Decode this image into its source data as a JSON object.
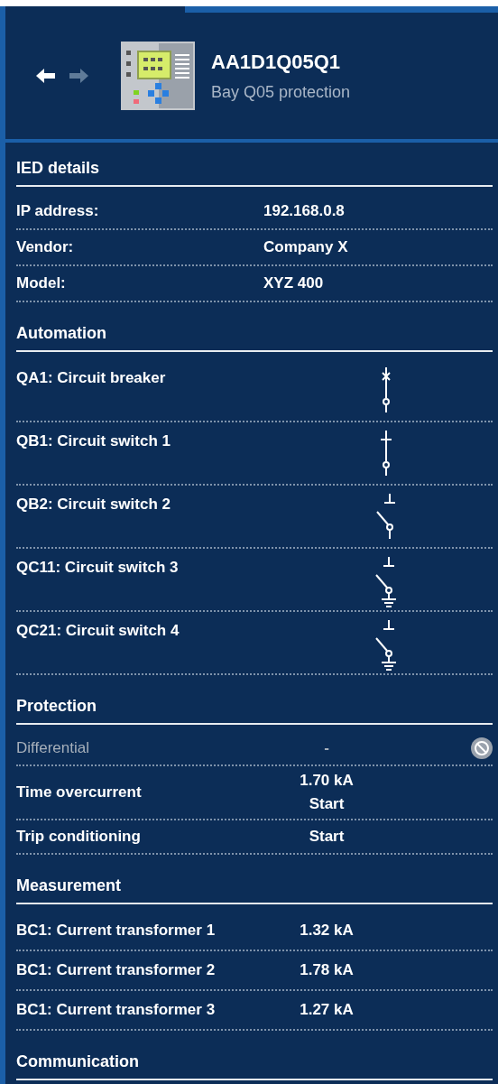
{
  "navigation": {
    "back": {
      "disabled": false
    },
    "forward": {
      "disabled": true
    }
  },
  "device": {
    "title": "AA1D1Q05Q1",
    "subtitle": "Bay Q05 protection"
  },
  "sections": [
    {
      "kind": "details",
      "heading": "IED details",
      "rows": [
        {
          "label": "IP address:",
          "values": [
            "192.168.0.8"
          ],
          "disabled": false
        },
        {
          "label": "Vendor:",
          "values": [
            "Company X"
          ],
          "disabled": false
        },
        {
          "label": "Model:",
          "values": [
            "XYZ 400"
          ],
          "disabled": false
        }
      ]
    },
    {
      "kind": "automation",
      "heading": "Automation",
      "rows": [
        {
          "label": "QA1: Circuit breaker",
          "kind": "breaker"
        },
        {
          "label": "QB1: Circuit switch 1",
          "kind": "closed"
        },
        {
          "label": "QB2: Circuit switch 2",
          "kind": "open"
        },
        {
          "label": "QC11: Circuit switch 3",
          "kind": "earthed"
        },
        {
          "label": "QC21: Circuit switch 4",
          "kind": "earthed"
        }
      ]
    },
    {
      "kind": "values",
      "heading": "Protection",
      "rows": [
        {
          "label": "Differential",
          "values": [
            "-"
          ],
          "disabled": true
        },
        {
          "label": "Time overcurrent",
          "values": [
            "1.70 kA",
            "Start"
          ],
          "disabled": false
        },
        {
          "label": "Trip conditioning",
          "values": [
            "Start"
          ],
          "disabled": false
        }
      ]
    },
    {
      "kind": "measurements",
      "heading": "Measurement",
      "rows": [
        {
          "label": "BC1: Current transformer 1",
          "values": [
            "1.32 kA"
          ],
          "disabled": false
        },
        {
          "label": "BC1: Current transformer 2",
          "values": [
            "1.78 kA"
          ],
          "disabled": false
        },
        {
          "label": "BC1: Current transformer 3",
          "values": [
            "1.27 kA"
          ],
          "disabled": false
        }
      ]
    },
    {
      "heading": "Communication"
    }
  ]
}
